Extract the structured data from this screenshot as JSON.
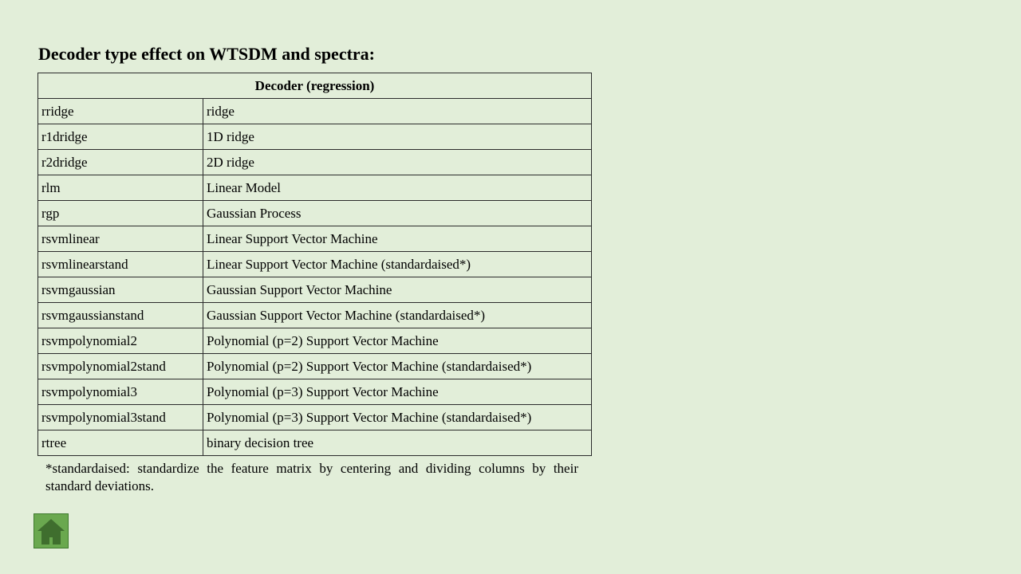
{
  "slide": {
    "title": "Decoder type effect on WTSDM and spectra:"
  },
  "table": {
    "header": "Decoder (regression)",
    "rows": [
      {
        "code": "rridge",
        "description": "ridge"
      },
      {
        "code": "r1dridge",
        "description": "1D ridge"
      },
      {
        "code": "r2dridge",
        "description": "2D ridge"
      },
      {
        "code": "rlm",
        "description": "Linear Model"
      },
      {
        "code": "rgp",
        "description": "Gaussian Process"
      },
      {
        "code": "rsvmlinear",
        "description": "Linear Support Vector Machine"
      },
      {
        "code": "rsvmlinearstand",
        "description": "Linear Support Vector Machine (standardaised*)"
      },
      {
        "code": "rsvmgaussian",
        "description": "Gaussian Support Vector Machine"
      },
      {
        "code": "rsvmgaussianstand",
        "description": "Gaussian Support Vector Machine (standardaised*)"
      },
      {
        "code": "rsvmpolynomial2",
        "description": "Polynomial (p=2) Support Vector Machine"
      },
      {
        "code": "rsvmpolynomial2stand",
        "description": "Polynomial (p=2) Support Vector Machine (standardaised*)"
      },
      {
        "code": "rsvmpolynomial3",
        "description": "Polynomial (p=3) Support Vector Machine"
      },
      {
        "code": "rsvmpolynomial3stand",
        "description": "Polynomial (p=3) Support Vector Machine (standardaised*)"
      },
      {
        "code": "rtree",
        "description": "binary decision tree"
      }
    ]
  },
  "footnote": "*standardaised: standardize the feature matrix by centering and dividing columns by their standard deviations.",
  "nav": {
    "home_icon": "home-icon"
  },
  "colors": {
    "background": "#e2eed9",
    "home_button": "#6aa84f",
    "home_icon": "#3f6e2e"
  }
}
